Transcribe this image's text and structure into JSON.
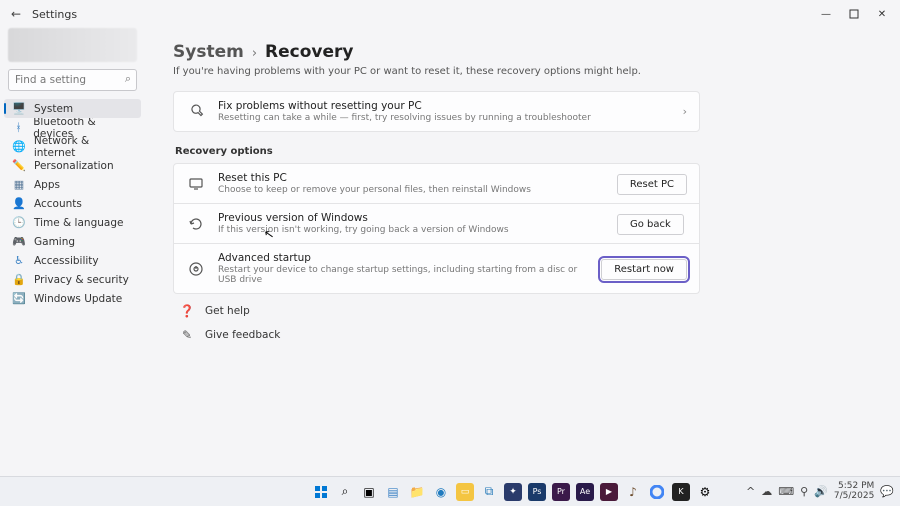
{
  "window": {
    "title": "Settings",
    "controls": {
      "min": "—",
      "max": "▢",
      "close": "✕"
    }
  },
  "sidebar": {
    "search_placeholder": "Find a setting",
    "items": [
      {
        "icon": "🖥️",
        "label": "System",
        "color": "#4a90d9",
        "selected": true
      },
      {
        "icon": "ᚼ",
        "label": "Bluetooth & devices",
        "color": "#3b82c4"
      },
      {
        "icon": "🌐",
        "label": "Network & internet",
        "color": "#4a7aa5"
      },
      {
        "icon": "✏️",
        "label": "Personalization",
        "color": "#c98b3e"
      },
      {
        "icon": "▦",
        "label": "Apps",
        "color": "#5a7a9a"
      },
      {
        "icon": "👤",
        "label": "Accounts",
        "color": "#6a6a6a"
      },
      {
        "icon": "🕒",
        "label": "Time & language",
        "color": "#c98b3e"
      },
      {
        "icon": "🎮",
        "label": "Gaming",
        "color": "#4aa56a"
      },
      {
        "icon": "♿",
        "label": "Accessibility",
        "color": "#3b82c4"
      },
      {
        "icon": "🔒",
        "label": "Privacy & security",
        "color": "#6a6a6a"
      },
      {
        "icon": "🔄",
        "label": "Windows Update",
        "color": "#c98b3e"
      }
    ]
  },
  "breadcrumb": {
    "parent": "System",
    "current": "Recovery"
  },
  "subtitle": "If you're having problems with your PC or want to reset it, these recovery options might help.",
  "topcard": {
    "title": "Fix problems without resetting your PC",
    "desc": "Resetting can take a while — first, try resolving issues by running a troubleshooter"
  },
  "section_label": "Recovery options",
  "options": [
    {
      "title": "Reset this PC",
      "desc": "Choose to keep or remove your personal files, then reinstall Windows",
      "button": "Reset PC",
      "focused": false
    },
    {
      "title": "Previous version of Windows",
      "desc": "If this version isn't working, try going back a version of Windows",
      "button": "Go back",
      "focused": false
    },
    {
      "title": "Advanced startup",
      "desc": "Restart your device to change startup settings, including starting from a disc or USB drive",
      "button": "Restart now",
      "focused": true
    }
  ],
  "help": [
    {
      "label": "Get help"
    },
    {
      "label": "Give feedback"
    }
  ],
  "taskbar": {
    "time": "5:52 PM",
    "date": "7/5/2025"
  }
}
